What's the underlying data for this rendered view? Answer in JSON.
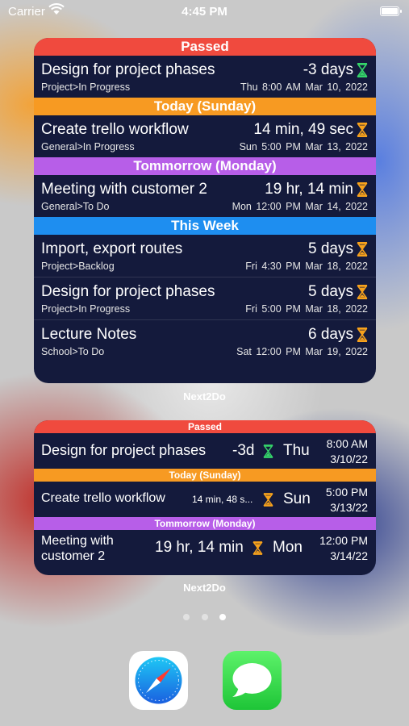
{
  "status_bar": {
    "carrier": "Carrier",
    "time": "4:45 PM"
  },
  "large_widget": {
    "sections": [
      {
        "header": "Passed",
        "tasks": [
          {
            "title": "Design for project phases",
            "path": "Project>In Progress",
            "countdown": "-3 days",
            "datetime": "Thu  8:00 AM  Mar 10, 2022",
            "hourglass": "green"
          }
        ]
      },
      {
        "header": "Today (Sunday)",
        "tasks": [
          {
            "title": "Create trello workflow",
            "path": "General>In Progress",
            "countdown": "14 min, 49 sec",
            "datetime": "Sun  5:00 PM  Mar 13, 2022",
            "hourglass": "orange"
          }
        ]
      },
      {
        "header": "Tommorrow (Monday)",
        "tasks": [
          {
            "title": "Meeting with customer 2",
            "path": "General>To Do",
            "countdown": "19 hr, 14 min",
            "datetime": "Mon  12:00 PM  Mar 14, 2022",
            "hourglass": "orange"
          }
        ]
      },
      {
        "header": "This Week",
        "tasks": [
          {
            "title": "Import, export routes",
            "path": "Project>Backlog",
            "countdown": "5 days",
            "datetime": "Fri  4:30 PM  Mar 18, 2022",
            "hourglass": "orange"
          },
          {
            "title": "Design for project phases",
            "path": "Project>In Progress",
            "countdown": "5 days",
            "datetime": "Fri  5:00 PM  Mar 18, 2022",
            "hourglass": "orange"
          },
          {
            "title": "Lecture Notes",
            "path": "School>To Do",
            "countdown": "6 days",
            "datetime": "Sat  12:00 PM  Mar 19, 2022",
            "hourglass": "orange"
          }
        ]
      }
    ],
    "label": "Next2Do"
  },
  "medium_widget": {
    "sections": [
      {
        "header": "Passed",
        "task": {
          "title": "Design for project phases",
          "countdown": "-3d",
          "day": "Thu",
          "time": "8:00 AM",
          "date": "3/10/22",
          "hourglass": "green"
        }
      },
      {
        "header": "Today (Sunday)",
        "task": {
          "title": "Create trello workflow",
          "countdown": "14 min, 48 s...",
          "day": "Sun",
          "time": "5:00 PM",
          "date": "3/13/22",
          "hourglass": "orange"
        }
      },
      {
        "header": "Tommorrow (Monday)",
        "task": {
          "title": "Meeting with customer 2",
          "countdown": "19 hr, 14 min",
          "day": "Mon",
          "time": "12:00 PM",
          "date": "3/14/22",
          "hourglass": "orange"
        }
      }
    ],
    "label": "Next2Do"
  },
  "page_dots": {
    "count": 3,
    "active_index": 2
  },
  "dock": {
    "apps": [
      "Safari",
      "Messages"
    ]
  },
  "colors": {
    "passed": "#f04a3e",
    "today": "#f79a22",
    "tomorrow": "#b75ee8",
    "this_week": "#1e8ef0",
    "widget_bg": "#141a3c",
    "hourglass_green": "#35d46a",
    "hourglass_orange": "#f7a21c"
  }
}
